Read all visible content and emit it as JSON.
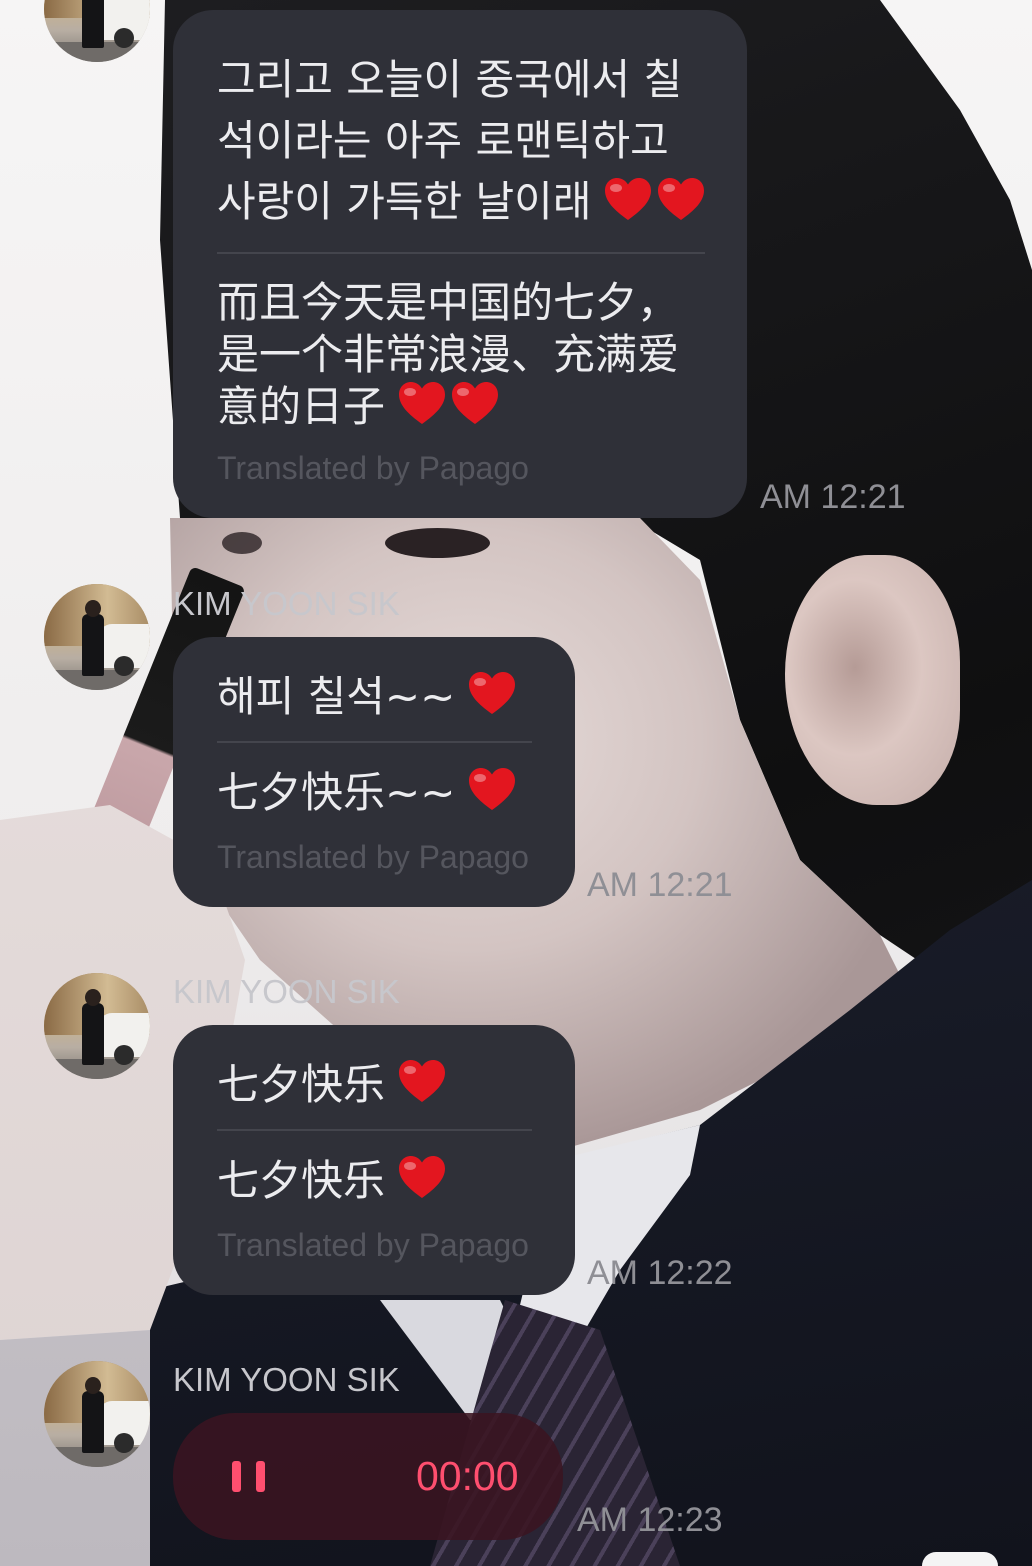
{
  "colors": {
    "bubble": "#2f3038",
    "bubble_text": "#ececef",
    "translation_credit": "#55565e",
    "divider": "#44454d",
    "timestamp": "#8f8f95",
    "sender_name": "#c7c7cc",
    "voice_bubble": "rgba(58,20,33,0.88)",
    "voice_accent": "#ff4f6f",
    "heart": "#e3161f"
  },
  "messages": [
    {
      "original": [
        {
          "text": "그리고 오늘이 중국에서 칠"
        },
        {
          "text": "석이라는 아주 로맨틱하고"
        },
        {
          "text": "사랑이 가득한 날이래",
          "hearts": 2
        }
      ],
      "translation": [
        {
          "text": "而且今天是中国的七夕，"
        },
        {
          "text": "是一个非常浪漫、充满爱"
        },
        {
          "text": "意的日子",
          "hearts": 2
        }
      ],
      "translation_credit": "Translated by Papago",
      "time": "AM 12:21"
    },
    {
      "sender": "KIM YOON SIK",
      "original": [
        {
          "text": "해피 칠석~~",
          "hearts": 1
        }
      ],
      "translation": [
        {
          "text": "七夕快乐~~",
          "hearts": 1
        }
      ],
      "translation_credit": "Translated by Papago",
      "time": "AM 12:21"
    },
    {
      "sender": "KIM YOON SIK",
      "original": [
        {
          "text": "七夕快乐",
          "hearts": 1
        }
      ],
      "translation": [
        {
          "text": "七夕快乐",
          "hearts": 1
        }
      ],
      "translation_credit": "Translated by Papago",
      "time": "AM 12:22"
    }
  ],
  "voice_message": {
    "sender": "KIM YOON SIK",
    "playback_icon": "pause-icon",
    "duration": "00:00",
    "time": "AM 12:23"
  }
}
